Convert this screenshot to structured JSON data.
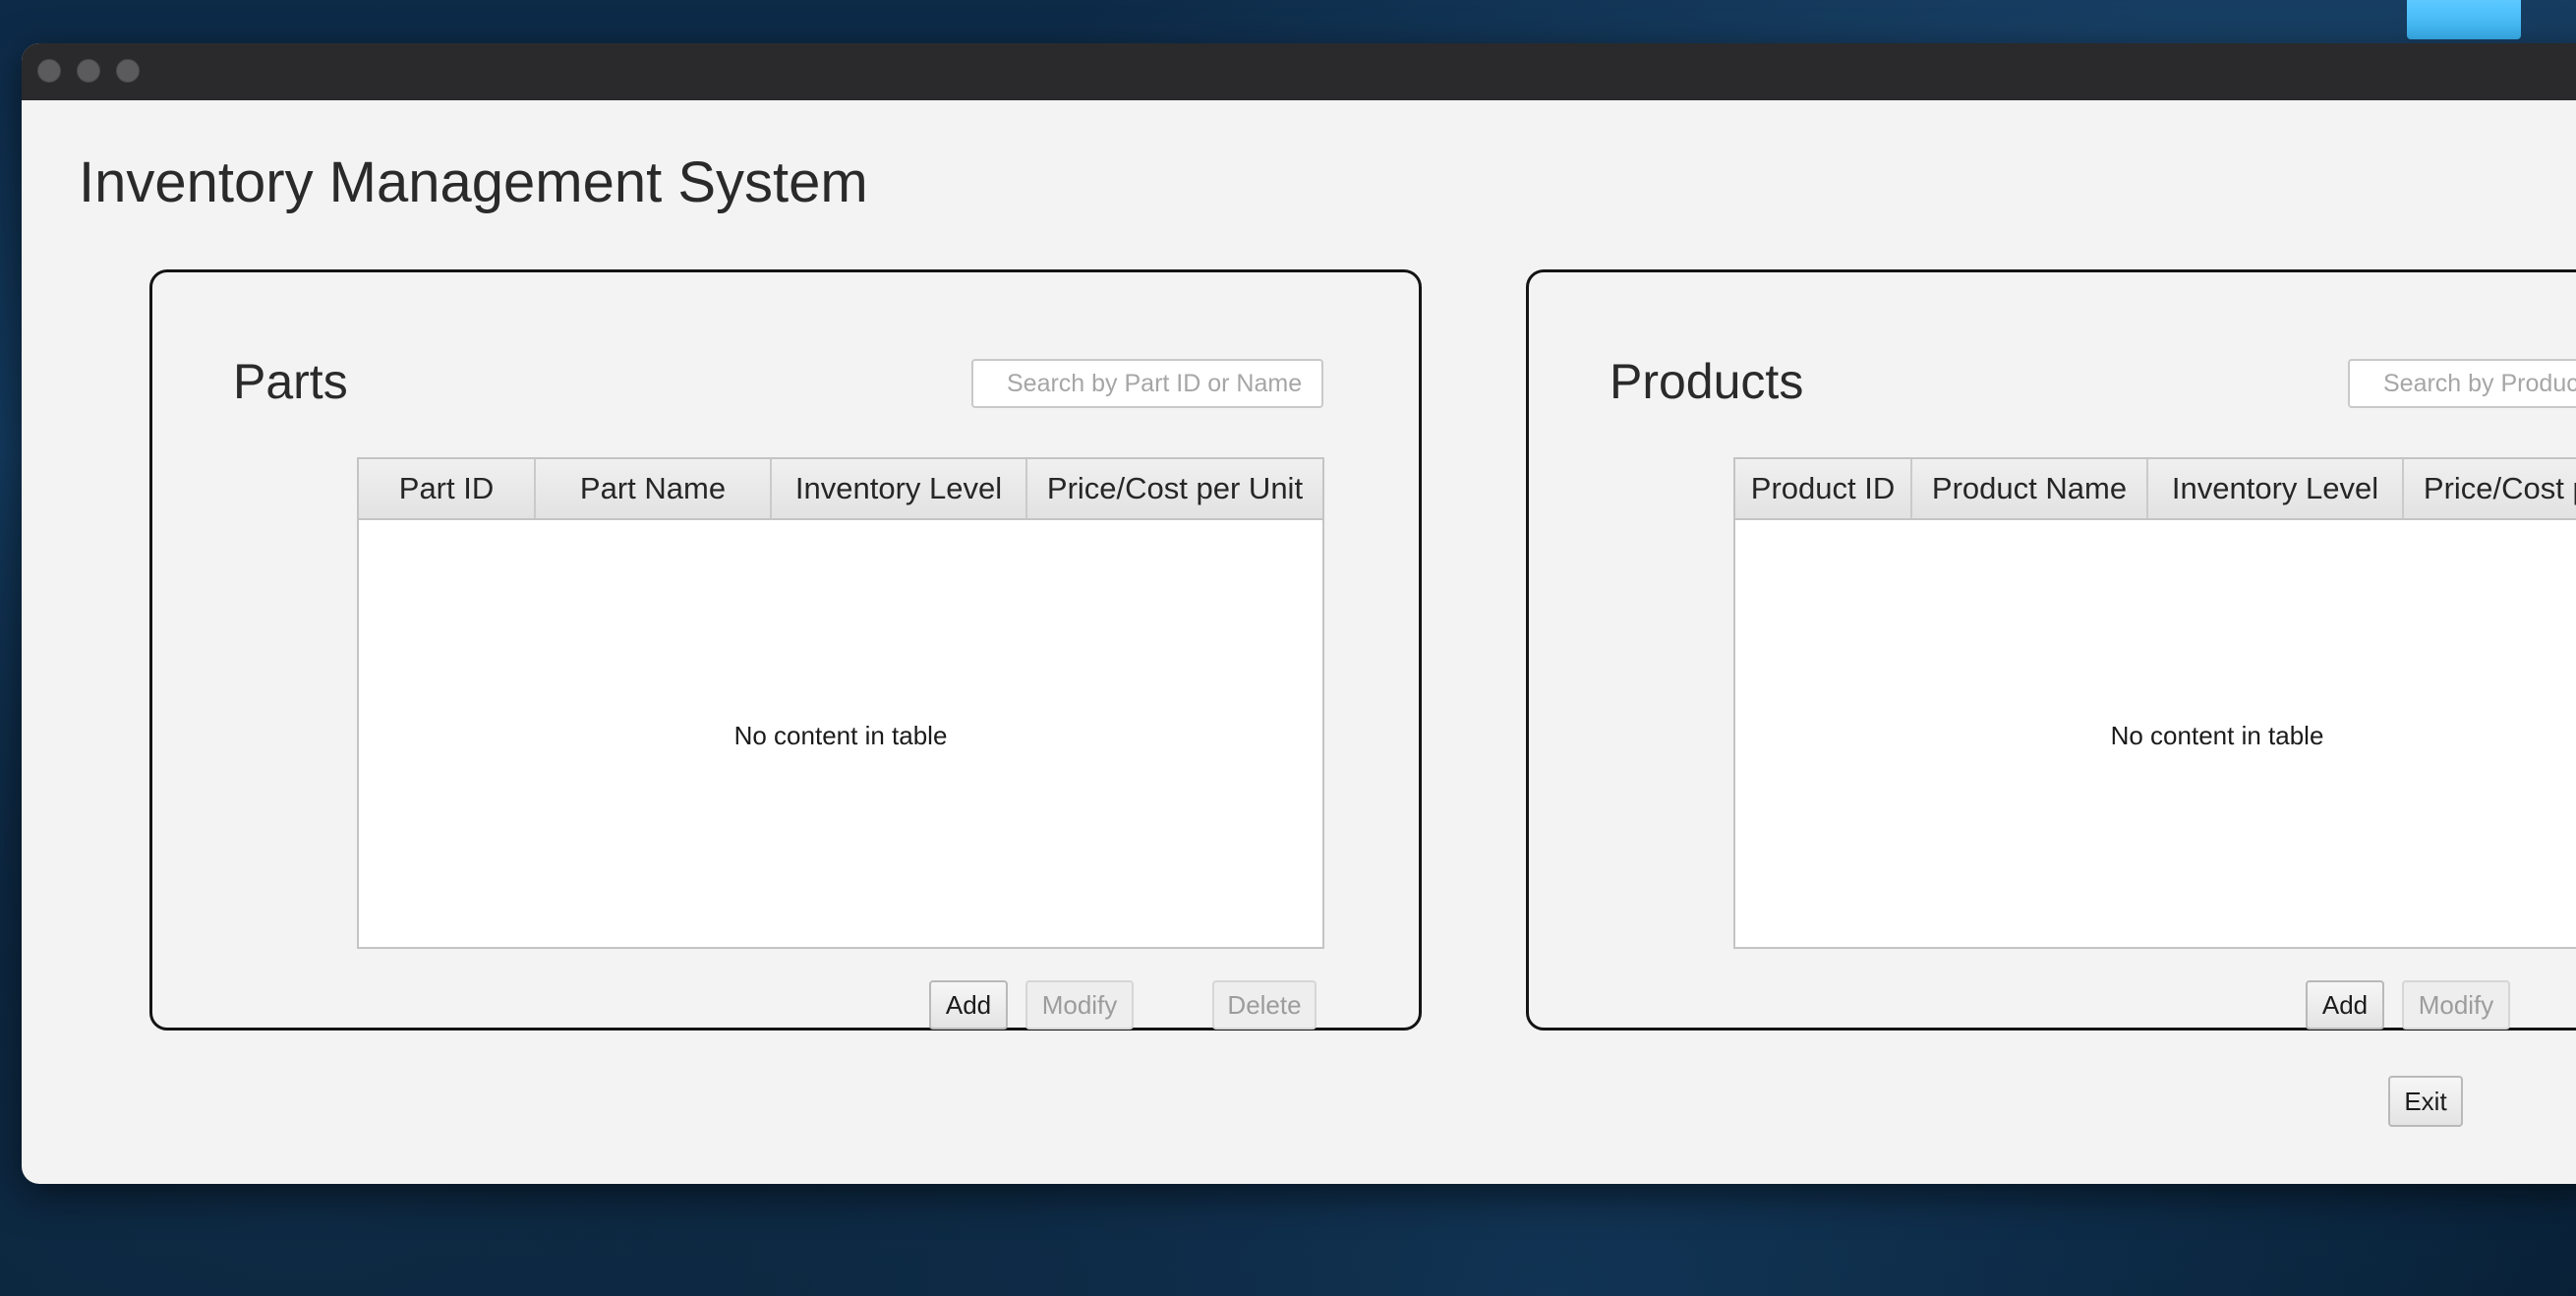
{
  "app": {
    "title": "Inventory Management System"
  },
  "parts": {
    "title": "Parts",
    "search_placeholder": "Search by Part ID or Name",
    "columns": [
      "Part ID",
      "Part Name",
      "Inventory Level",
      "Price/Cost per Unit"
    ],
    "empty_message": "No content in table",
    "buttons": {
      "add": "Add",
      "modify": "Modify",
      "delete": "Delete"
    }
  },
  "products": {
    "title": "Products",
    "search_placeholder": "Search by Product ID or Name",
    "columns": [
      "Product ID",
      "Product Name",
      "Inventory Level",
      "Price/Cost per Unit"
    ],
    "empty_message": "No content in table",
    "buttons": {
      "add": "Add",
      "modify": "Modify"
    }
  },
  "footer": {
    "exit_label": "Exit"
  },
  "colors": {
    "window_bg": "#f3f3f3",
    "titlebar": "#2a2a2c",
    "panel_border": "#141414",
    "desktop_accent": "#3ab5f5"
  }
}
